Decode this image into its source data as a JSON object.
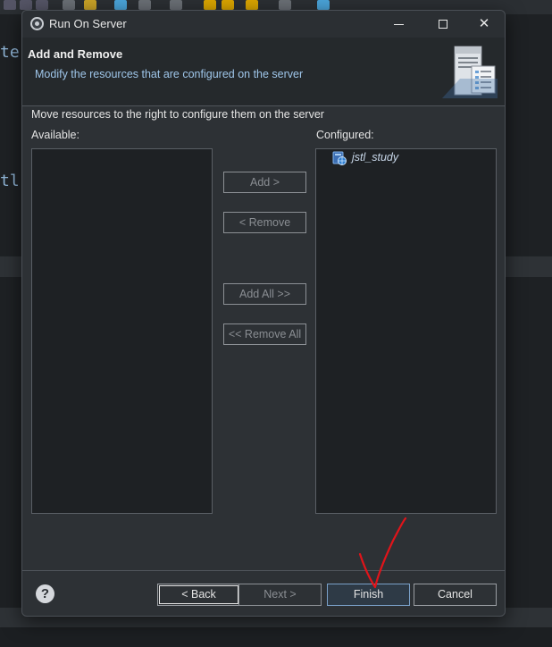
{
  "background": {
    "code_fragment_1": "te",
    "code_fragment_2": "tl"
  },
  "dialog": {
    "title": "Run On Server",
    "window_controls": {
      "minimize_icon": "minimize-icon",
      "maximize_icon": "maximize-icon",
      "close_icon": "close-icon"
    },
    "close_glyph": "✕"
  },
  "header": {
    "title": "Add and Remove",
    "description": "Modify the resources that are configured on the server",
    "art_icon": "server-icon"
  },
  "body": {
    "instruction": "Move resources to the right to configure them on the server",
    "available_label": "Available:",
    "configured_label": "Configured:",
    "available_items": [],
    "configured_items": [
      {
        "label": "jstl_study",
        "icon": "web-project-icon"
      }
    ]
  },
  "buttons": {
    "add": "Add >",
    "remove": "< Remove",
    "add_all": "Add All >>",
    "remove_all": "<< Remove All"
  },
  "footer": {
    "help_glyph": "?",
    "back": "< Back",
    "next": "Next >",
    "finish": "Finish",
    "cancel": "Cancel"
  },
  "colors": {
    "accent_text": "#9fc6ea",
    "annotation_red": "#e0141a"
  }
}
